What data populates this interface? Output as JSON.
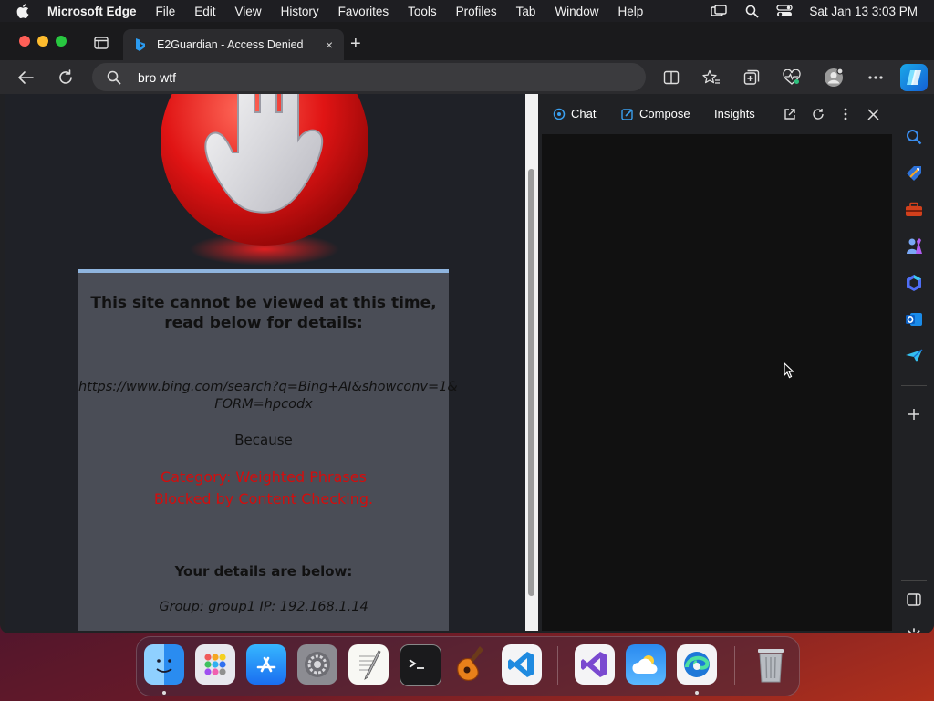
{
  "menubar": {
    "app_name": "Microsoft Edge",
    "items": [
      "File",
      "Edit",
      "View",
      "History",
      "Favorites",
      "Tools",
      "Profiles",
      "Tab",
      "Window",
      "Help"
    ],
    "clock": "Sat Jan 13  3:03 PM"
  },
  "tab": {
    "title": "E2Guardian - Access Denied",
    "close_glyph": "×",
    "new_tab_glyph": "+"
  },
  "address": {
    "value": "bro wtf"
  },
  "page": {
    "heading": "This site cannot be viewed at this time, read below for details:",
    "blocked_url_line1": "https://www.bing.com/search?q=Bing+AI&showconv=1&",
    "blocked_url_line2": "FORM=hpcodx",
    "because": "Because",
    "reason_line1": "Category: Weighted Phrases",
    "reason_line2": "Blocked by Content Checking.",
    "details_heading": "Your details are below:",
    "group_line": "Group: group1   IP: 192.168.1.14"
  },
  "pane": {
    "tabs": [
      "Chat",
      "Compose",
      "Insights"
    ]
  },
  "dock": {
    "apps": [
      "finder-icon",
      "launchpad-icon",
      "app-store-icon",
      "system-settings-icon",
      "textedit-icon",
      "terminal-icon",
      "garageband-icon",
      "vscode-icon",
      "visual-studio-icon",
      "weather-icon",
      "edge-icon",
      "trash-icon"
    ]
  },
  "colors": {
    "reason_red": "#d40d0d",
    "box_top_border": "#8fb5df",
    "copilot_accent": "#1a8fe8"
  }
}
